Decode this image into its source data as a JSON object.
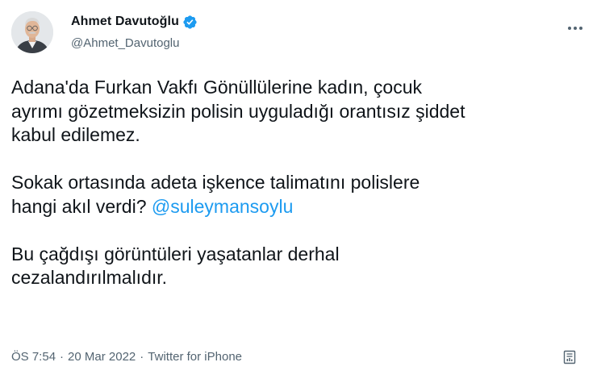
{
  "author": {
    "display_name": "Ahmet Davutoğlu",
    "handle": "@Ahmet_Davutoglu",
    "verified": true
  },
  "tweet": {
    "line1": "Adana'da Furkan Vakfı Gönüllülerine kadın, çocuk",
    "line2": "ayrımı gözetmeksizin polisin uyguladığı orantısız şiddet",
    "line3": "kabul edilemez.",
    "line4": "Sokak ortasında adeta işkence talimatını polislere",
    "line5_text": "hangi akıl verdi? ",
    "mention": "@suleymansoylu",
    "line6": "Bu çağdışı görüntüleri yaşatanlar derhal",
    "line7": "cezalandırılmalıdır."
  },
  "meta": {
    "time": "ÖS 7:54",
    "separator1": "·",
    "date": "20 Mar 2022",
    "separator2": "·",
    "source": "Twitter for iPhone"
  },
  "icons": {
    "verified": "verified-badge-icon",
    "more": "more-options-icon",
    "analytics": "tweet-analytics-icon"
  },
  "colors": {
    "text": "#0f1419",
    "secondary": "#536471",
    "accent": "#1d9bf0"
  }
}
